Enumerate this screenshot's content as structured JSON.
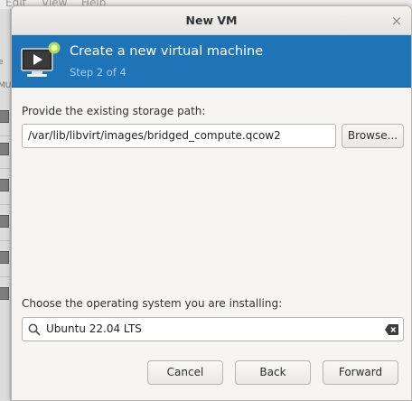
{
  "background": {
    "menu": [
      "Edit",
      "View",
      "Help"
    ],
    "strip_fragments": [
      "e",
      "MU"
    ]
  },
  "dialog": {
    "title": "New VM",
    "close_glyph": "×",
    "banner": {
      "title": "Create a new virtual machine",
      "step": "Step 2 of 4",
      "icon": "vm-monitor-icon",
      "color": "#1f73b7"
    },
    "storage": {
      "label": "Provide the existing storage path:",
      "path_value": "/var/lib/libvirt/images/bridged_compute.qcow2",
      "browse_label": "Browse..."
    },
    "os": {
      "label": "Choose the operating system you are installing:",
      "search_value": "Ubuntu 22.04 LTS",
      "search_icon": "search-icon",
      "clear_icon": "clear-icon"
    },
    "buttons": {
      "cancel": "Cancel",
      "back": "Back",
      "forward": "Forward"
    }
  }
}
